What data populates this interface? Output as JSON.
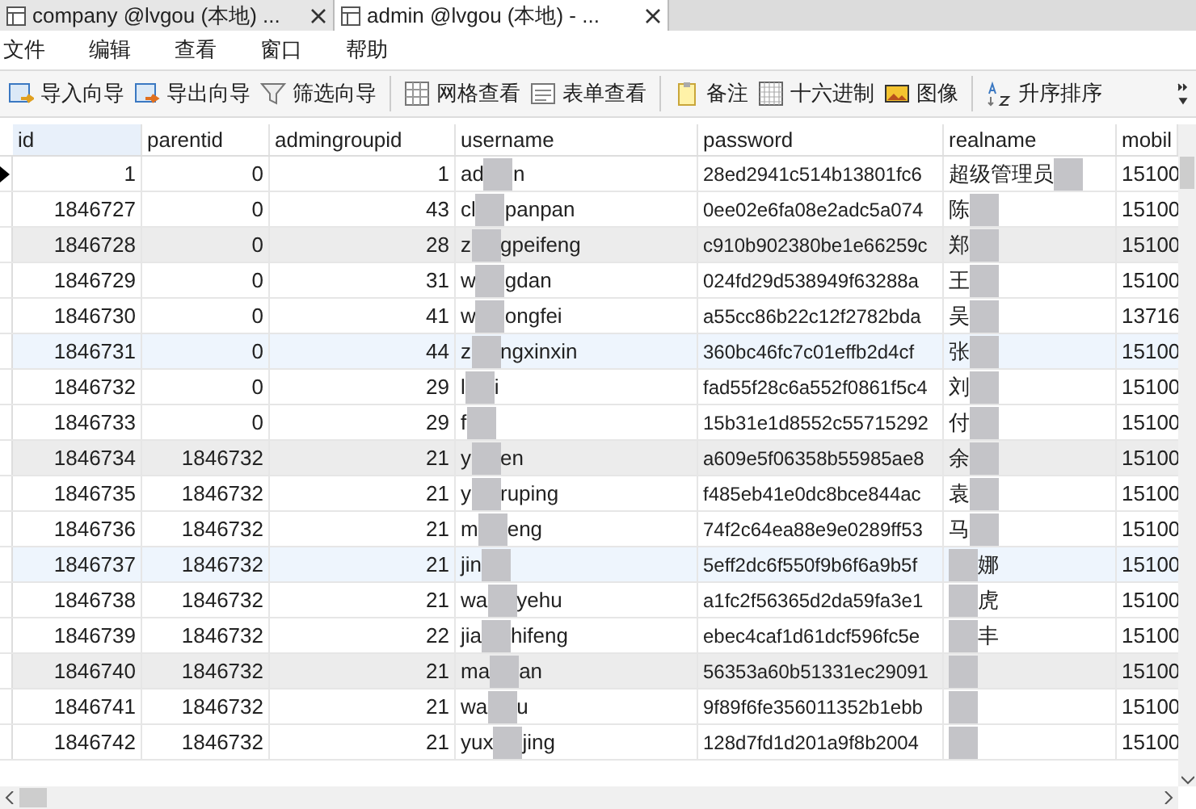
{
  "tabs": [
    {
      "label": "company @lvgou (本地) ...",
      "selected": false
    },
    {
      "label": "admin @lvgou (本地) - ...",
      "selected": true
    }
  ],
  "menu": [
    "文件",
    "编辑",
    "查看",
    "窗口",
    "帮助"
  ],
  "toolbar": [
    {
      "label": "导入向导",
      "kind": "import"
    },
    {
      "label": "导出向导",
      "kind": "export"
    },
    {
      "label": "筛选向导",
      "kind": "filter"
    },
    {
      "kind": "separator"
    },
    {
      "label": "网格查看",
      "kind": "grid"
    },
    {
      "label": "表单查看",
      "kind": "form"
    },
    {
      "kind": "separator"
    },
    {
      "label": "备注",
      "kind": "note"
    },
    {
      "label": "十六进制",
      "kind": "hex"
    },
    {
      "label": "图像",
      "kind": "image"
    },
    {
      "kind": "separator"
    },
    {
      "label": "升序排序",
      "kind": "sort"
    }
  ],
  "table": {
    "columns": [
      "id",
      "parentid",
      "admingroupid",
      "username",
      "password",
      "realname",
      "mobil"
    ],
    "rows": [
      {
        "id": "1",
        "parentid": "0",
        "admingroupid": "1",
        "username": {
          "start": "ad",
          "end": "n"
        },
        "password": "28ed2941c514b13801fc6",
        "realname": {
          "start": "超级管理员"
        },
        "mobile": "15100",
        "selected": false,
        "banded": false,
        "current": true
      },
      {
        "id": "1846727",
        "parentid": "0",
        "admingroupid": "43",
        "username": {
          "start": "cl",
          "end": "panpan"
        },
        "password": "0ee02e6fa08e2adc5a074",
        "realname": {
          "start": "陈"
        },
        "mobile": "15100",
        "selected": false,
        "banded": false,
        "current": false
      },
      {
        "id": "1846728",
        "parentid": "0",
        "admingroupid": "28",
        "username": {
          "start": "z",
          "end": "gpeifeng"
        },
        "password": "c910b902380be1e66259c",
        "realname": {
          "start": "郑"
        },
        "mobile": "15100",
        "selected": false,
        "banded": true,
        "current": false
      },
      {
        "id": "1846729",
        "parentid": "0",
        "admingroupid": "31",
        "username": {
          "start": "w",
          "end": "gdan"
        },
        "password": "024fd29d538949f63288a",
        "realname": {
          "start": "王"
        },
        "mobile": "15100",
        "selected": false,
        "banded": false,
        "current": false
      },
      {
        "id": "1846730",
        "parentid": "0",
        "admingroupid": "41",
        "username": {
          "start": "w",
          "end": "ongfei"
        },
        "password": "a55cc86b22c12f2782bda",
        "realname": {
          "start": "吴"
        },
        "mobile": "13716",
        "selected": false,
        "banded": false,
        "current": false
      },
      {
        "id": "1846731",
        "parentid": "0",
        "admingroupid": "44",
        "username": {
          "start": "z",
          "end": "ngxinxin"
        },
        "password": "360bc46fc7c01effb2d4cf",
        "realname": {
          "start": "张"
        },
        "mobile": "15100",
        "selected": true,
        "banded": false,
        "current": false
      },
      {
        "id": "1846732",
        "parentid": "0",
        "admingroupid": "29",
        "username": {
          "start": "l",
          "end": "i"
        },
        "password": "fad55f28c6a552f0861f5c4",
        "realname": {
          "start": "刘"
        },
        "mobile": "15100",
        "selected": false,
        "banded": false,
        "current": false
      },
      {
        "id": "1846733",
        "parentid": "0",
        "admingroupid": "29",
        "username": {
          "start": "f"
        },
        "password": "15b31e1d8552c55715292",
        "realname": {
          "start": "付"
        },
        "mobile": "15100",
        "selected": false,
        "banded": false,
        "current": false
      },
      {
        "id": "1846734",
        "parentid": "1846732",
        "admingroupid": "21",
        "username": {
          "start": "y",
          "end": "en"
        },
        "password": "a609e5f06358b55985ae8",
        "realname": {
          "start": "余"
        },
        "mobile": "15100",
        "selected": false,
        "banded": true,
        "current": false
      },
      {
        "id": "1846735",
        "parentid": "1846732",
        "admingroupid": "21",
        "username": {
          "start": "y",
          "end": "ruping"
        },
        "password": "f485eb41e0dc8bce844ac",
        "realname": {
          "start": "袁"
        },
        "mobile": "15100",
        "selected": false,
        "banded": false,
        "current": false
      },
      {
        "id": "1846736",
        "parentid": "1846732",
        "admingroupid": "21",
        "username": {
          "start": "m",
          "end": "eng"
        },
        "password": "74f2c64ea88e9e0289ff53",
        "realname": {
          "start": "马"
        },
        "mobile": "15100",
        "selected": false,
        "banded": false,
        "current": false
      },
      {
        "id": "1846737",
        "parentid": "1846732",
        "admingroupid": "21",
        "username": {
          "start": "jin"
        },
        "password": "5eff2dc6f550f9b6f6a9b5f",
        "realname": {
          "end": "娜"
        },
        "mobile": "15100",
        "selected": true,
        "banded": false,
        "current": false
      },
      {
        "id": "1846738",
        "parentid": "1846732",
        "admingroupid": "21",
        "username": {
          "start": "wa",
          "end": "yehu"
        },
        "password": "a1fc2f56365d2da59fa3e1",
        "realname": {
          "end": "虎"
        },
        "mobile": "15100",
        "selected": false,
        "banded": false,
        "current": false
      },
      {
        "id": "1846739",
        "parentid": "1846732",
        "admingroupid": "22",
        "username": {
          "start": "jia",
          "end": "hifeng"
        },
        "password": "ebec4caf1d61dcf596fc5e",
        "realname": {
          "end": "丰"
        },
        "mobile": "15100",
        "selected": false,
        "banded": false,
        "current": false
      },
      {
        "id": "1846740",
        "parentid": "1846732",
        "admingroupid": "21",
        "username": {
          "start": "ma",
          "end": "an"
        },
        "password": "56353a60b51331ec29091",
        "mobile": "15100",
        "selected": false,
        "banded": true,
        "current": false
      },
      {
        "id": "1846741",
        "parentid": "1846732",
        "admingroupid": "21",
        "username": {
          "start": "wa",
          "end": "u"
        },
        "password": "9f89f6fe356011352b1ebb",
        "mobile": "15100",
        "selected": false,
        "banded": false,
        "current": false
      },
      {
        "id": "1846742",
        "parentid": "1846732",
        "admingroupid": "21",
        "username": {
          "start": "yux",
          "end": "jing"
        },
        "password": "128d7fd1d201a9f8b2004",
        "mobile": "15100",
        "selected": false,
        "banded": false,
        "current": false
      }
    ]
  }
}
